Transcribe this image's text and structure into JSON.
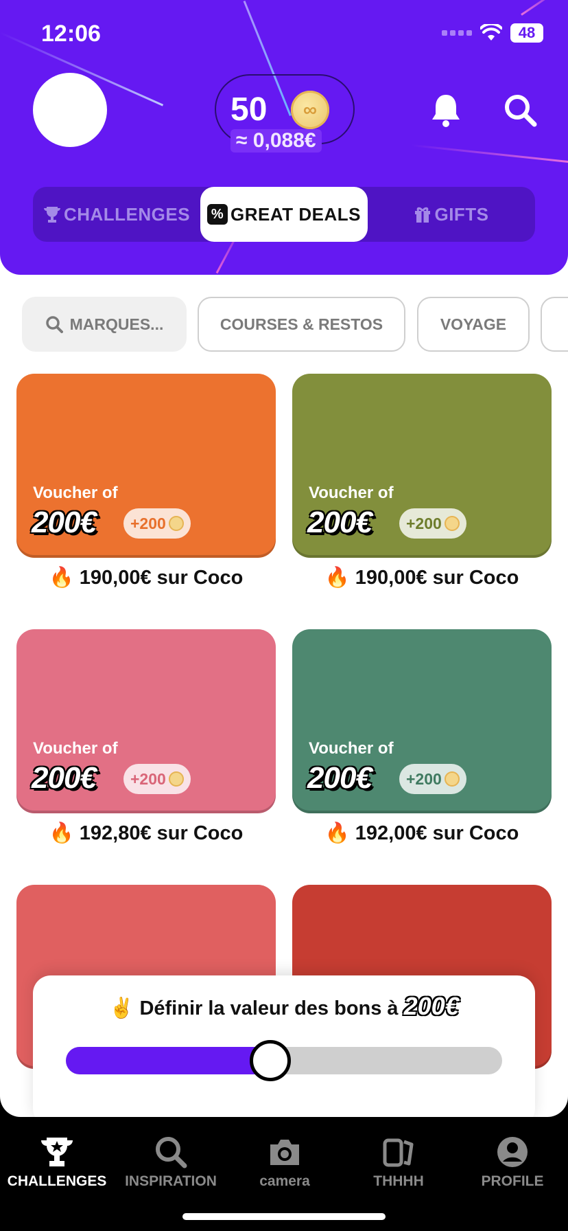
{
  "status_bar": {
    "time": "12:06",
    "battery": "48"
  },
  "wallet": {
    "coins": "50",
    "euro_value": "≈ 0,088€",
    "coin_glyph": "∞"
  },
  "tabs": [
    {
      "label": "CHALLENGES",
      "icon": "trophy-icon"
    },
    {
      "label": "GREAT DEALS",
      "icon": "percent-icon",
      "active": true
    },
    {
      "label": "GIFTS",
      "icon": "gift-icon"
    }
  ],
  "filters": [
    {
      "label": "MARQUES...",
      "icon": "search-icon"
    },
    {
      "label": "COURSES & RESTOS"
    },
    {
      "label": "VOYAGE"
    },
    {
      "label": ""
    }
  ],
  "cards": [
    {
      "label": "Voucher of",
      "amount": "200€",
      "bonus": "+200",
      "price": "🔥 190,00€ sur Coco",
      "color": "#ec722f",
      "bonus_color": "#e8702c"
    },
    {
      "label": "Voucher of",
      "amount": "200€",
      "bonus": "+200",
      "price": "🔥 190,00€ sur Coco",
      "color": "#828f3c",
      "bonus_color": "#6e7d2c"
    },
    {
      "label": "Voucher of",
      "amount": "200€",
      "bonus": "+200",
      "price": "🔥 192,80€ sur Coco",
      "color": "#e27085",
      "bonus_color": "#d96578"
    },
    {
      "label": "Voucher of",
      "amount": "200€",
      "bonus": "+200",
      "price": "🔥 192,00€ sur Coco",
      "color": "#4e8870",
      "bonus_color": "#3f7a60"
    },
    {
      "label": "",
      "amount": "",
      "bonus": "",
      "price": "",
      "color": "#e06060",
      "bonus_color": "#c04040"
    },
    {
      "label": "",
      "amount": "",
      "bonus": "",
      "price": "",
      "color": "#c63d32",
      "bonus_color": "#a83028"
    }
  ],
  "slider": {
    "emoji": "✌️",
    "title": "Définir la valeur des bons à",
    "amount": "200€",
    "value_fraction": 0.39
  },
  "bottom_nav": [
    {
      "label": "CHALLENGES",
      "icon": "trophy-icon",
      "active": true
    },
    {
      "label": "INSPIRATION",
      "icon": "search-icon"
    },
    {
      "label": "camera",
      "icon": "camera-icon"
    },
    {
      "label": "THHHH",
      "icon": "cards-icon"
    },
    {
      "label": "PROFILE",
      "icon": "user-icon"
    }
  ],
  "colors": {
    "brand": "#6519f2",
    "tabs_bg": "#4f14c4"
  }
}
